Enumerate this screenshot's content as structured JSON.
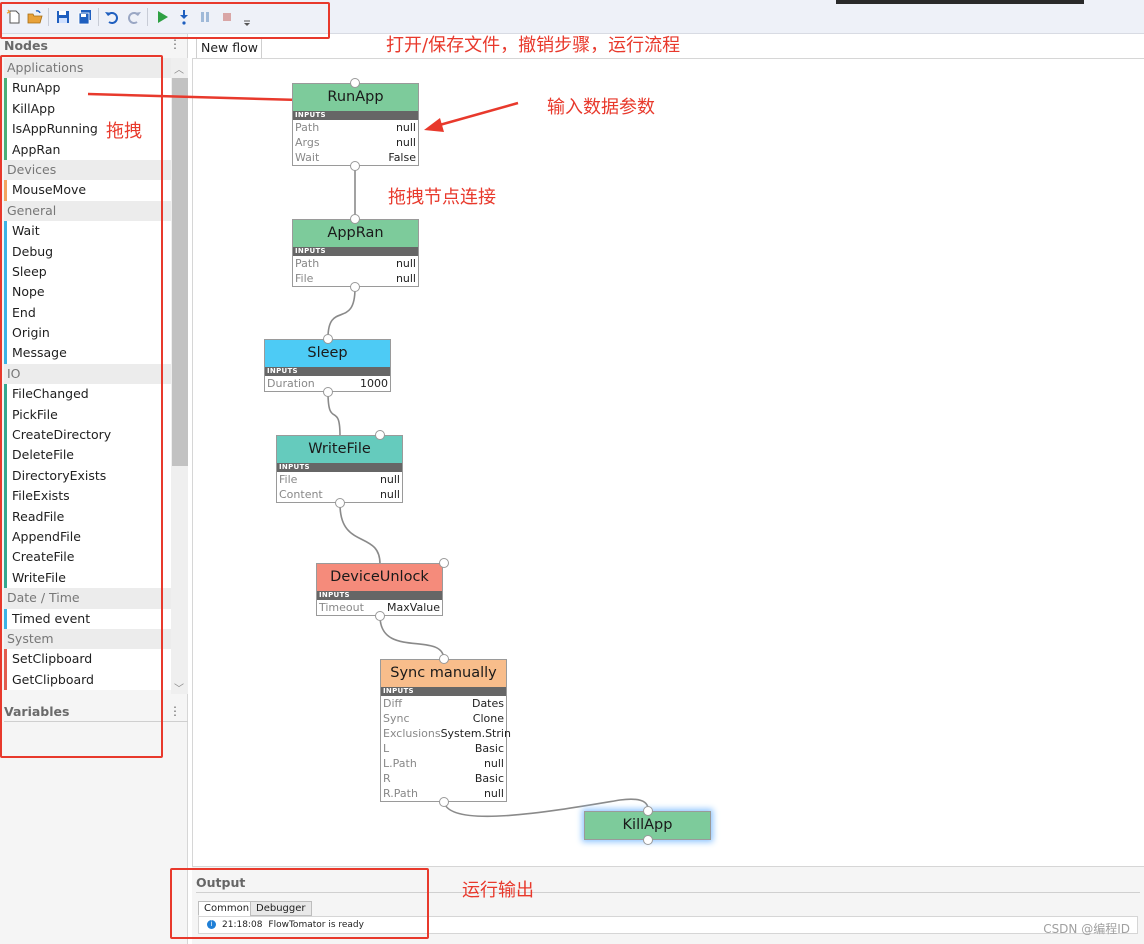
{
  "toolbar": {
    "buttons": [
      {
        "name": "new-file-icon",
        "color": "#e8a23a"
      },
      {
        "name": "open-file-icon",
        "color": "#e8a23a"
      },
      {
        "name": "save-icon",
        "color": "#1f5fbf"
      },
      {
        "name": "save-as-icon",
        "color": "#1f5fbf"
      },
      {
        "name": "undo-icon",
        "color": "#1f5fbf"
      },
      {
        "name": "redo-icon",
        "color": "#9aa7c4"
      },
      {
        "name": "run-icon",
        "color": "#2ea043"
      },
      {
        "name": "step-icon",
        "color": "#1f5fbf"
      },
      {
        "name": "pause-icon",
        "color": "#9fb9d8"
      },
      {
        "name": "stop-icon",
        "color": "#d9a6a6"
      },
      {
        "name": "overflow-icon",
        "color": "#555555"
      }
    ]
  },
  "left_panel": {
    "nodes_title": "Nodes",
    "variables_title": "Variables",
    "categories": [
      {
        "name": "Applications",
        "color": "green",
        "items": [
          "RunApp",
          "KillApp",
          "IsAppRunning",
          "AppRan"
        ]
      },
      {
        "name": "Devices",
        "color": "orange",
        "items": [
          "MouseMove"
        ]
      },
      {
        "name": "General",
        "color": "blue",
        "items": [
          "Wait",
          "Debug",
          "Sleep",
          "Nope",
          "End",
          "Origin",
          "Message"
        ]
      },
      {
        "name": "IO",
        "color": "teal",
        "items": [
          "FileChanged",
          "PickFile",
          "CreateDirectory",
          "DeleteFile",
          "DirectoryExists",
          "FileExists",
          "ReadFile",
          "AppendFile",
          "CreateFile",
          "WriteFile"
        ]
      },
      {
        "name": "Date / Time",
        "color": "blue",
        "items": [
          "Timed event"
        ]
      },
      {
        "name": "System",
        "color": "red",
        "items": [
          "SetClipboard",
          "GetClipboard"
        ]
      }
    ]
  },
  "tab": {
    "label": "New flow"
  },
  "flow": {
    "inputs_label": "INPUTS",
    "nodes": {
      "runapp": {
        "title": "RunApp",
        "color": "#7dcb9b",
        "rows": [
          {
            "k": "Path",
            "v": "null"
          },
          {
            "k": "Args",
            "v": "null"
          },
          {
            "k": "Wait",
            "v": "False"
          }
        ]
      },
      "appran": {
        "title": "AppRan",
        "color": "#7dcb9b",
        "rows": [
          {
            "k": "Path",
            "v": "null"
          },
          {
            "k": "File",
            "v": "null"
          }
        ]
      },
      "sleep": {
        "title": "Sleep",
        "color": "#4dcbf5",
        "rows": [
          {
            "k": "Duration",
            "v": "1000"
          }
        ]
      },
      "writefile": {
        "title": "WriteFile",
        "color": "#65cbbd",
        "rows": [
          {
            "k": "File",
            "v": "null"
          },
          {
            "k": "Content",
            "v": "null"
          }
        ]
      },
      "deviceunlock": {
        "title": "DeviceUnlock",
        "color": "#f58b7b",
        "rows": [
          {
            "k": "Timeout",
            "v": "MaxValue"
          }
        ]
      },
      "syncmanually": {
        "title": "Sync manually",
        "color": "#f8bd8b",
        "rows": [
          {
            "k": "Diff",
            "v": "Dates"
          },
          {
            "k": "Sync",
            "v": "Clone"
          },
          {
            "k": "Exclusions",
            "v": "System.Strin"
          },
          {
            "k": "L",
            "v": "Basic"
          },
          {
            "k": "L.Path",
            "v": "null"
          },
          {
            "k": "R",
            "v": "Basic"
          },
          {
            "k": "R.Path",
            "v": "null"
          }
        ]
      },
      "killapp": {
        "title": "KillApp",
        "color": "#7dcb9b",
        "rows": []
      }
    }
  },
  "annotations": {
    "toolbar_note": "打开/保存文件，撤销步骤，运行流程",
    "drag_note": "拖拽",
    "params_note": "输入数据参数",
    "connect_note": "拖拽节点连接",
    "output_note": "运行输出",
    "color": "#e8392c"
  },
  "output": {
    "title": "Output",
    "tabs": [
      "Common",
      "Debugger"
    ],
    "log": {
      "time": "21:18:08",
      "message": "FlowTomator is ready"
    }
  },
  "watermark": "CSDN @编程ID"
}
